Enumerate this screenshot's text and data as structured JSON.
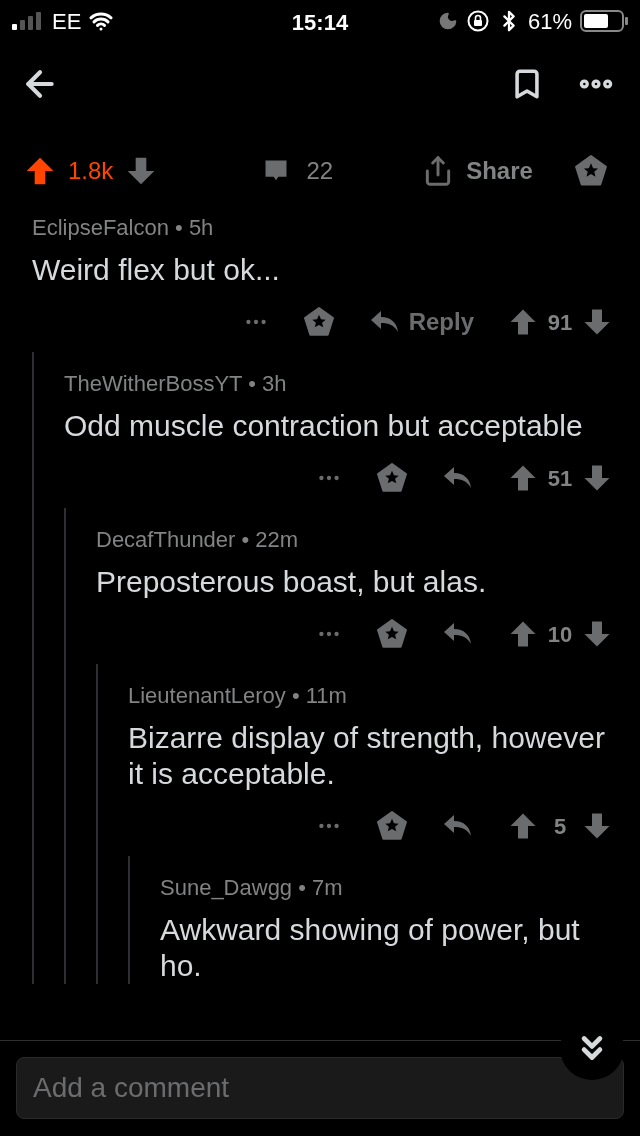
{
  "status_bar": {
    "carrier": "EE",
    "time": "15:14",
    "battery": "61%"
  },
  "post_actions": {
    "upvoted": true,
    "score": "1.8k",
    "comments": "22",
    "share": "Share"
  },
  "comments": [
    {
      "byline": "EclipseFalcon • 5h",
      "body": "Weird flex but ok...",
      "reply_label": "Reply",
      "upvoted": false,
      "score": "91",
      "children": [
        {
          "byline": "TheWitherBossYT • 3h",
          "body": "Odd muscle contraction but acceptable",
          "upvoted": false,
          "score": "51",
          "children": [
            {
              "byline": "DecafThunder • 22m",
              "body": "Preposterous boast, but alas.",
              "upvoted": false,
              "score": "10",
              "children": [
                {
                  "byline": "LieutenantLeroy • 11m",
                  "body": "Bizarre display of strength, however it is acceptable.",
                  "upvoted": false,
                  "score": "5",
                  "children": [
                    {
                      "byline": "Sune_Dawgg • 7m",
                      "body": "Awkward showing of power, but ho."
                    }
                  ]
                }
              ]
            }
          ]
        }
      ]
    }
  ],
  "composer": {
    "placeholder": "Add a comment"
  }
}
